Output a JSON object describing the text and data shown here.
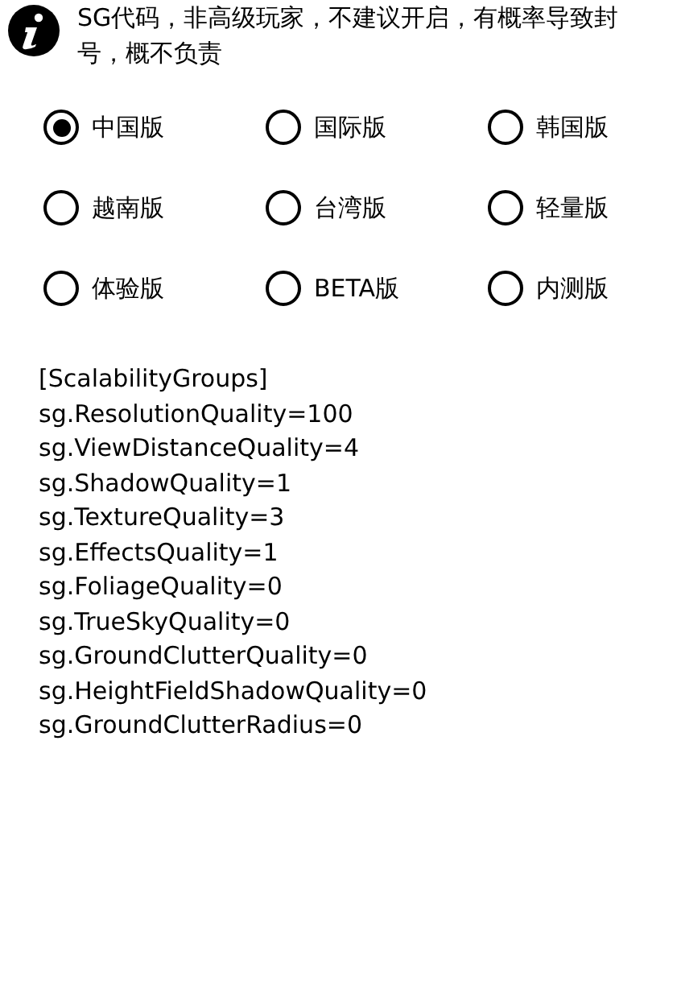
{
  "notice": "SG代码，非高级玩家，不建议开启，有概率导致封号，概不负责",
  "versions": [
    {
      "label": "中国版",
      "selected": true
    },
    {
      "label": "国际版",
      "selected": false
    },
    {
      "label": "韩国版",
      "selected": false
    },
    {
      "label": "越南版",
      "selected": false
    },
    {
      "label": "台湾版",
      "selected": false
    },
    {
      "label": "轻量版",
      "selected": false
    },
    {
      "label": "体验版",
      "selected": false
    },
    {
      "label": "BETA版",
      "selected": false
    },
    {
      "label": "内测版",
      "selected": false
    }
  ],
  "config_lines": [
    "[ScalabilityGroups]",
    "sg.ResolutionQuality=100",
    "sg.ViewDistanceQuality=4",
    "sg.ShadowQuality=1",
    "sg.TextureQuality=3",
    "sg.EffectsQuality=1",
    "sg.FoliageQuality=0",
    "sg.TrueSkyQuality=0",
    "sg.GroundClutterQuality=0",
    "sg.HeightFieldShadowQuality=0",
    "sg.GroundClutterRadius=0"
  ]
}
